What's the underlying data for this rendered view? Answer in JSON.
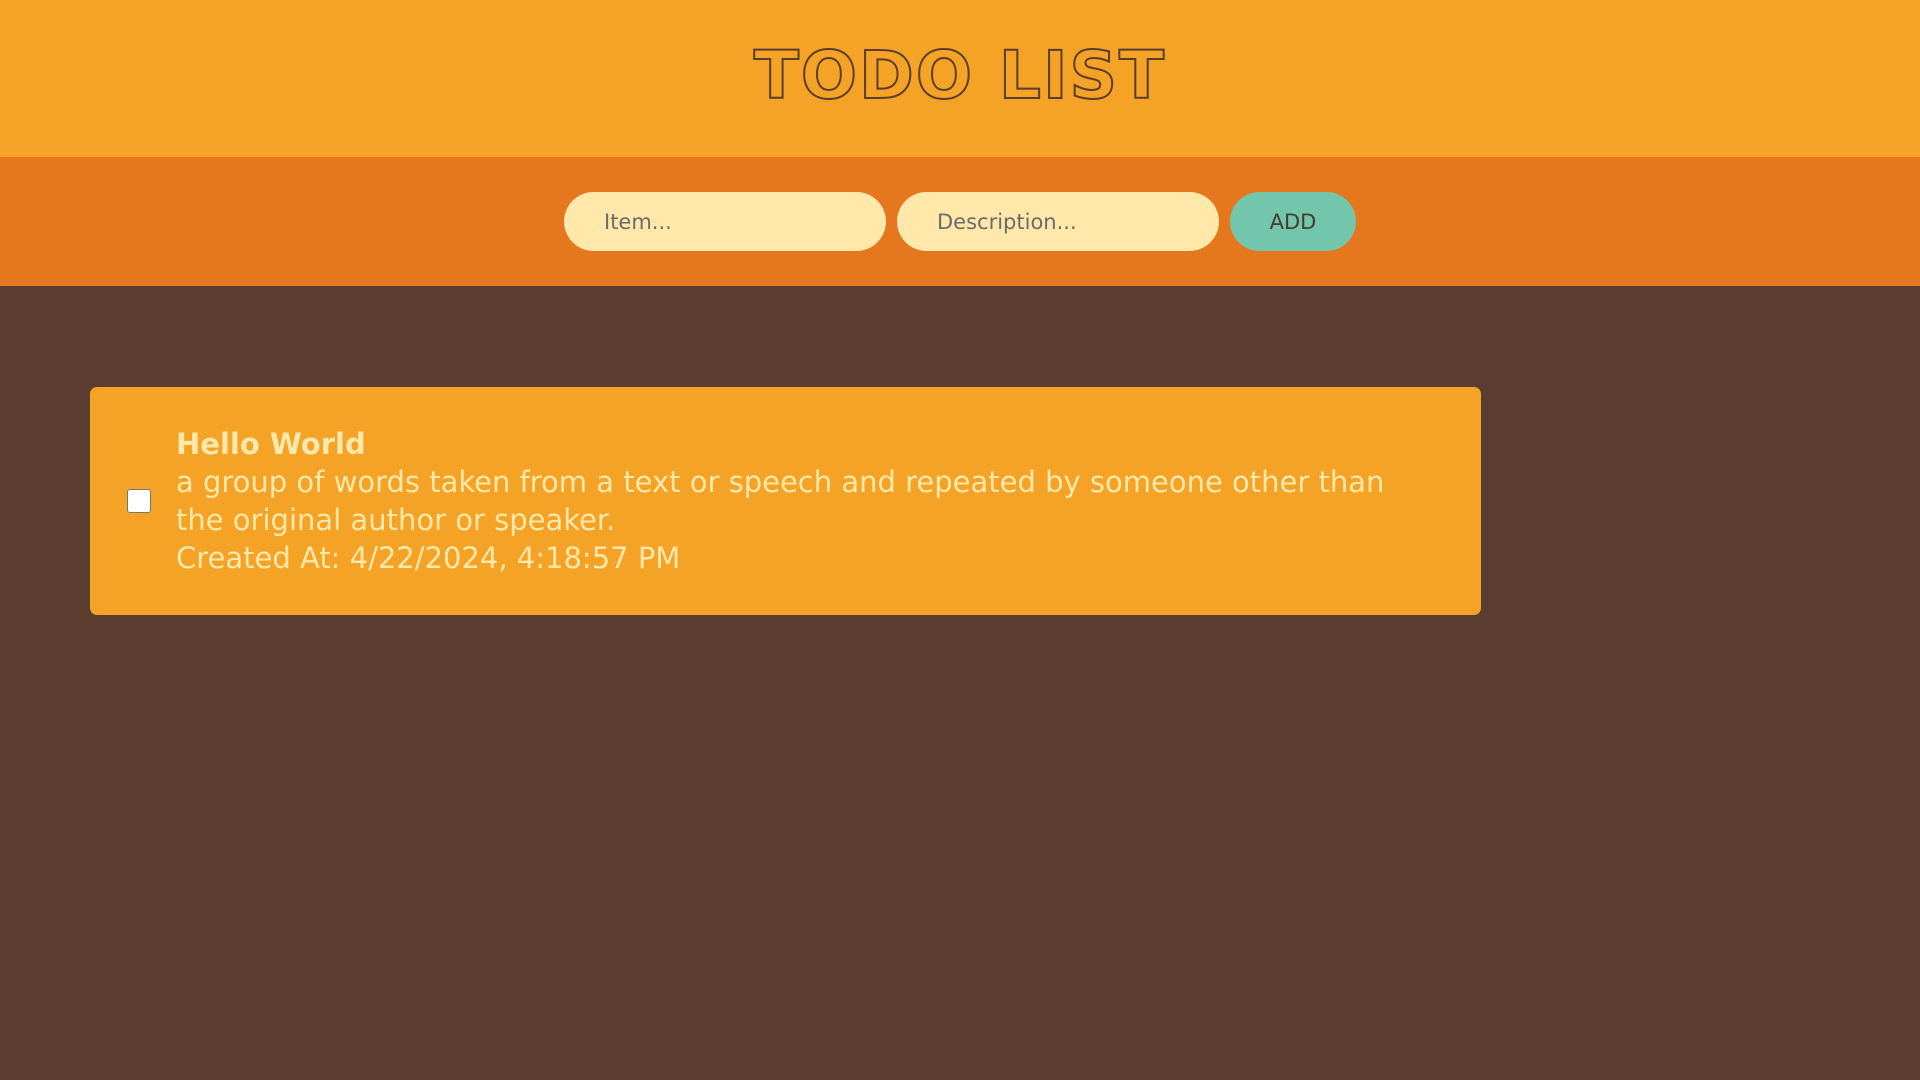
{
  "header": {
    "title": "TODO LIST"
  },
  "form": {
    "item_placeholder": "Item...",
    "description_placeholder": "Description...",
    "add_label": "ADD"
  },
  "todos": [
    {
      "title": "Hello World",
      "description": "a group of words taken from a text or speech and repeated by someone other than the original author or speaker.",
      "created": "Created At: 4/22/2024, 4:18:57 PM",
      "checked": false
    }
  ],
  "colors": {
    "header_bg": "#f4a326",
    "input_bar_bg": "#e5771e",
    "page_bg": "#5a3d2e",
    "input_bg": "#ffe8aa",
    "button_bg": "#72c6ab",
    "card_bg": "#f4a326",
    "card_text": "#ffe8aa"
  }
}
